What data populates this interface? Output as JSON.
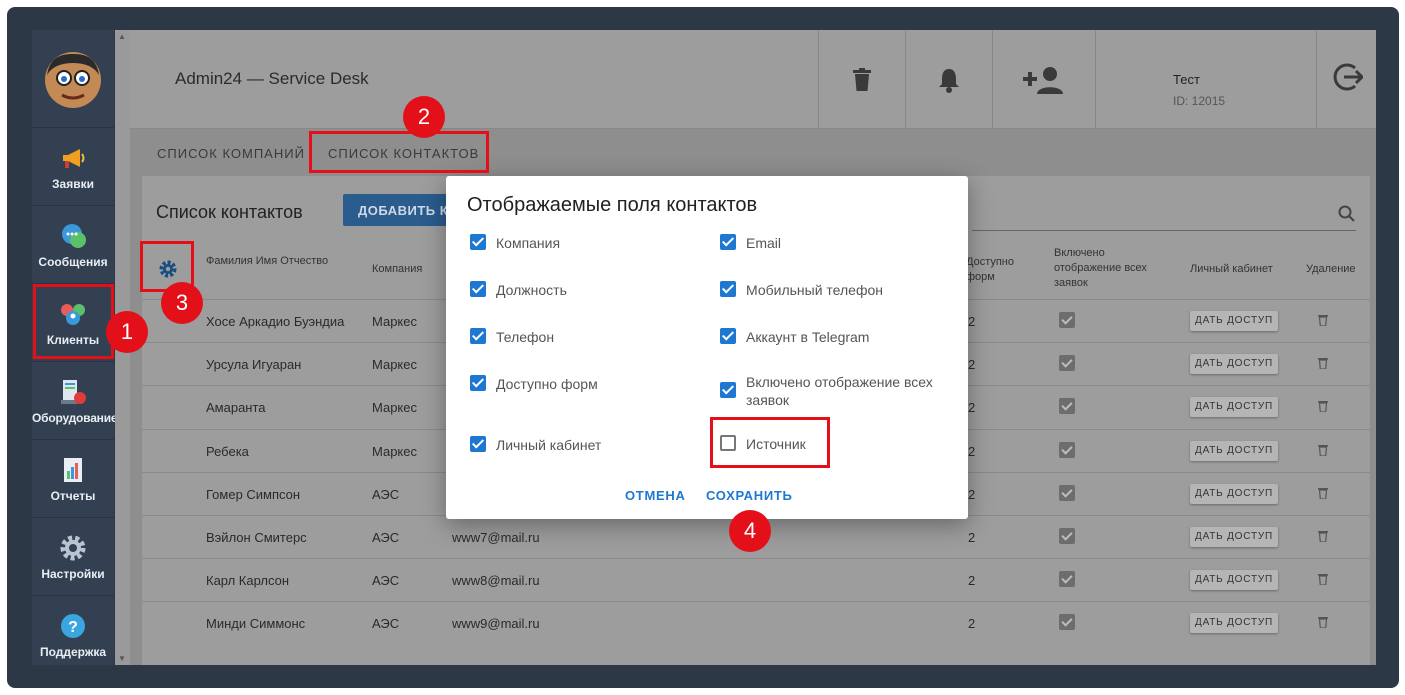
{
  "app": {
    "title": "Admin24 — Service Desk"
  },
  "user": {
    "name": "Тест",
    "id": "ID: 12015"
  },
  "sidebar": {
    "items": [
      {
        "label": "Заявки",
        "icon": "megaphone-icon"
      },
      {
        "label": "Сообщения",
        "icon": "chat-icon"
      },
      {
        "label": "Клиенты",
        "icon": "people-icon"
      },
      {
        "label": "Оборудование",
        "icon": "equipment-icon"
      },
      {
        "label": "Отчеты",
        "icon": "report-icon"
      },
      {
        "label": "Настройки",
        "icon": "gear-icon"
      },
      {
        "label": "Поддержка",
        "icon": "help-icon"
      }
    ]
  },
  "tabs": [
    "СПИСОК КОМПАНИЙ",
    "СПИСОК КОНТАКТОВ"
  ],
  "panel": {
    "title": "Список контактов",
    "add_button": "ДОБАВИТЬ К",
    "columns": {
      "name": "Фамилия Имя Отчество",
      "company": "Компания",
      "forms": "Доступно форм",
      "all_requests": "Включено отображение всех заявок",
      "cabinet": "Личный кабинет",
      "delete": "Удаление"
    },
    "give_access": "ДАТЬ ДОСТУП",
    "rows": [
      {
        "name": "Хосе Аркадио Буэндиа",
        "company": "Маркес",
        "email": "",
        "forms": "2"
      },
      {
        "name": "Урсула Игуаран",
        "company": "Маркес",
        "email": "",
        "forms": "2"
      },
      {
        "name": "Амаранта",
        "company": "Маркес",
        "email": "",
        "forms": "2"
      },
      {
        "name": "Ребека",
        "company": "Маркес",
        "email": "",
        "forms": "2"
      },
      {
        "name": "Гомер Симпсон",
        "company": "АЭС",
        "email": "",
        "forms": "2"
      },
      {
        "name": "Вэйлон Смитерс",
        "company": "АЭС",
        "email": "www7@mail.ru",
        "forms": "2"
      },
      {
        "name": "Карл Карлсон",
        "company": "АЭС",
        "email": "www8@mail.ru",
        "forms": "2"
      },
      {
        "name": "Минди Симмонс",
        "company": "АЭС",
        "email": "www9@mail.ru",
        "forms": "2"
      }
    ]
  },
  "modal": {
    "title": "Отображаемые поля контактов",
    "left": [
      {
        "label": "Компания",
        "checked": true
      },
      {
        "label": "Должность",
        "checked": true
      },
      {
        "label": "Телефон",
        "checked": true
      },
      {
        "label": "Доступно форм",
        "checked": true
      },
      {
        "label": "Личный кабинет",
        "checked": true
      }
    ],
    "right": [
      {
        "label": "Email",
        "checked": true
      },
      {
        "label": "Мобильный телефон",
        "checked": true
      },
      {
        "label": "Аккаунт в Telegram",
        "checked": true
      },
      {
        "label": "Включено отображение всех заявок",
        "checked": true
      },
      {
        "label": "Источник",
        "checked": false
      }
    ],
    "cancel": "ОТМЕНА",
    "save": "СОХРАНИТЬ"
  },
  "annotations": [
    "1",
    "2",
    "3",
    "4"
  ],
  "colors": {
    "accent": "#1e78d2",
    "annotation": "#e3101a",
    "sidebar": "#324051"
  }
}
